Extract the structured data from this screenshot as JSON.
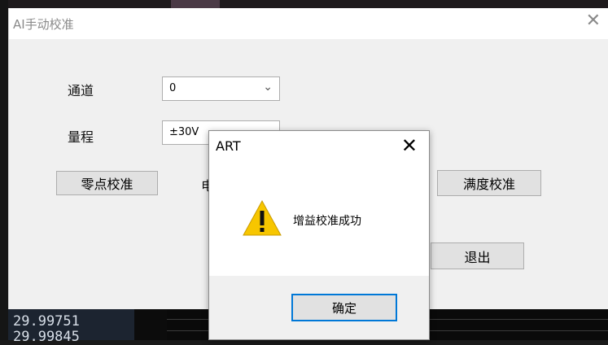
{
  "main_window": {
    "title": "AI手动校准",
    "close_glyph": "✕",
    "channel_label": "通道",
    "channel_value": "0",
    "range_label": "量程",
    "range_value": "±30V",
    "zero_cal_button": "零点校准",
    "partial_label": "电",
    "full_scale_button": "满度校准",
    "exit_button": "退出"
  },
  "readout": {
    "line1": "29.99751",
    "line2": "29.99845"
  },
  "dialog": {
    "title": "ART",
    "close_glyph": "✕",
    "message": "增益校准成功",
    "ok_button": "确定",
    "icon": "warning-icon"
  },
  "colors": {
    "accent": "#0078d7",
    "warning_yellow": "#f7c600"
  }
}
